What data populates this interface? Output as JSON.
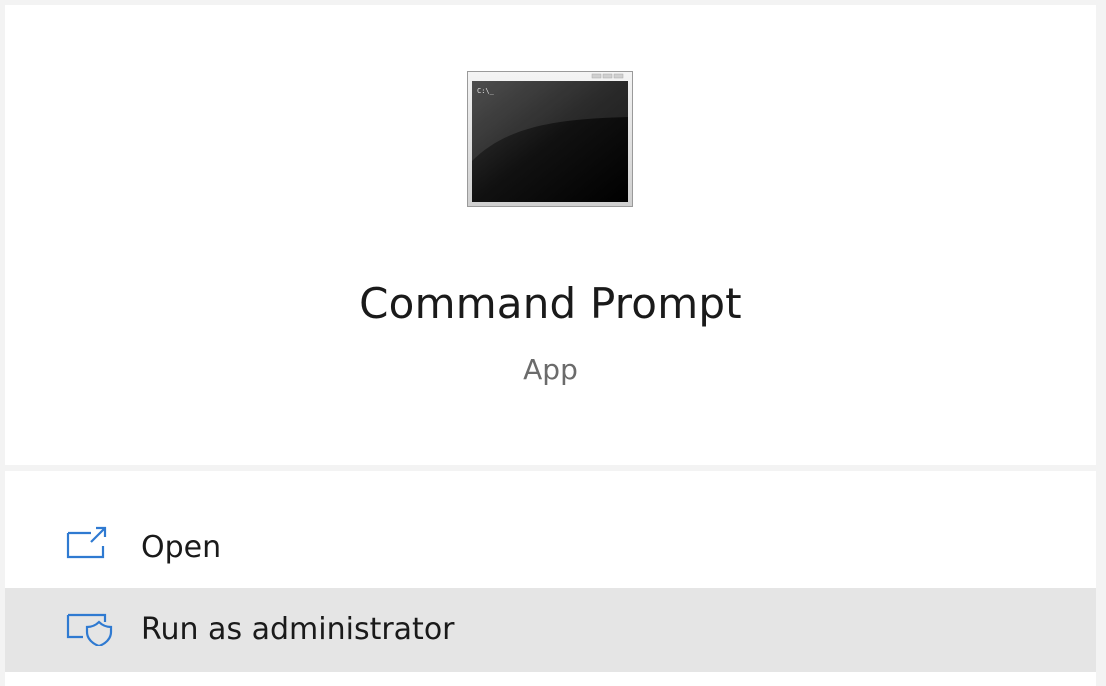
{
  "app": {
    "icon": "command-prompt-app-icon",
    "icon_prompt_text": "C:\\_",
    "title": "Command Prompt",
    "type": "App"
  },
  "actions": [
    {
      "label": "Open",
      "icon": "open-window-icon",
      "highlighted": false
    },
    {
      "label": "Run as administrator",
      "icon": "shield-window-icon",
      "highlighted": true
    }
  ],
  "colors": {
    "accent": "#2f7ad1",
    "hover_bg": "#e5e5e5",
    "panel_bg": "#ffffff",
    "frame_bg": "#f3f3f3"
  }
}
